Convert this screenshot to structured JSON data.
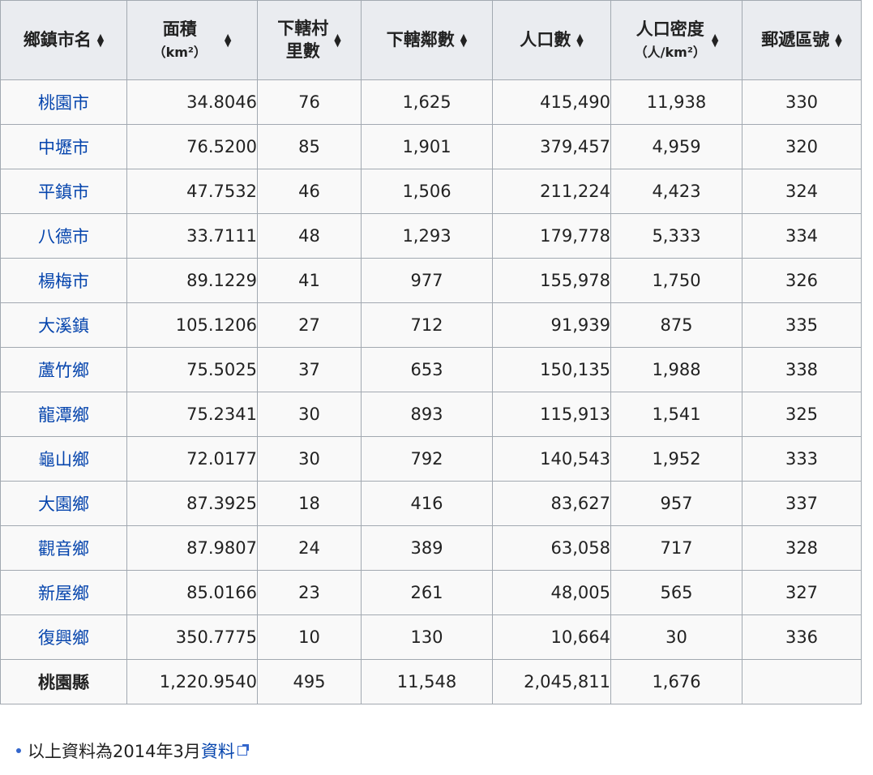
{
  "headers": {
    "name": "鄉鎮市名",
    "area": "面積",
    "area_unit": "（km²）",
    "villages_l1": "下轄村",
    "villages_l2": "里數",
    "neighborhoods": "下轄鄰數",
    "population": "人口數",
    "density": "人口密度",
    "density_unit": "（人/km²）",
    "postal": "郵遞區號"
  },
  "rows": [
    {
      "name": "桃園市",
      "area": "34.8046",
      "villages": "76",
      "neighborhoods": "1,625",
      "population": "415,490",
      "density": "11,938",
      "postal": "330"
    },
    {
      "name": "中壢市",
      "area": "76.5200",
      "villages": "85",
      "neighborhoods": "1,901",
      "population": "379,457",
      "density": "4,959",
      "postal": "320"
    },
    {
      "name": "平鎮市",
      "area": "47.7532",
      "villages": "46",
      "neighborhoods": "1,506",
      "population": "211,224",
      "density": "4,423",
      "postal": "324"
    },
    {
      "name": "八德市",
      "area": "33.7111",
      "villages": "48",
      "neighborhoods": "1,293",
      "population": "179,778",
      "density": "5,333",
      "postal": "334"
    },
    {
      "name": "楊梅市",
      "area": "89.1229",
      "villages": "41",
      "neighborhoods": "977",
      "population": "155,978",
      "density": "1,750",
      "postal": "326"
    },
    {
      "name": "大溪鎮",
      "area": "105.1206",
      "villages": "27",
      "neighborhoods": "712",
      "population": "91,939",
      "density": "875",
      "postal": "335"
    },
    {
      "name": "蘆竹鄉",
      "area": "75.5025",
      "villages": "37",
      "neighborhoods": "653",
      "population": "150,135",
      "density": "1,988",
      "postal": "338"
    },
    {
      "name": "龍潭鄉",
      "area": "75.2341",
      "villages": "30",
      "neighborhoods": "893",
      "population": "115,913",
      "density": "1,541",
      "postal": "325"
    },
    {
      "name": "龜山鄉",
      "area": "72.0177",
      "villages": "30",
      "neighborhoods": "792",
      "population": "140,543",
      "density": "1,952",
      "postal": "333"
    },
    {
      "name": "大園鄉",
      "area": "87.3925",
      "villages": "18",
      "neighborhoods": "416",
      "population": "83,627",
      "density": "957",
      "postal": "337"
    },
    {
      "name": "觀音鄉",
      "area": "87.9807",
      "villages": "24",
      "neighborhoods": "389",
      "population": "63,058",
      "density": "717",
      "postal": "328"
    },
    {
      "name": "新屋鄉",
      "area": "85.0166",
      "villages": "23",
      "neighborhoods": "261",
      "population": "48,005",
      "density": "565",
      "postal": "327"
    },
    {
      "name": "復興鄉",
      "area": "350.7775",
      "villages": "10",
      "neighborhoods": "130",
      "population": "10,664",
      "density": "30",
      "postal": "336"
    }
  ],
  "total": {
    "name": "桃園縣",
    "area": "1,220.9540",
    "villages": "495",
    "neighborhoods": "11,548",
    "population": "2,045,811",
    "density": "1,676",
    "postal": ""
  },
  "note": {
    "text": "以上資料為2014年3月",
    "link": "資料"
  },
  "colors": {
    "link": "#0645ad",
    "header_bg": "#eaecf0",
    "cell_bg": "#f9f9f9",
    "border": "#a2a9b1"
  }
}
